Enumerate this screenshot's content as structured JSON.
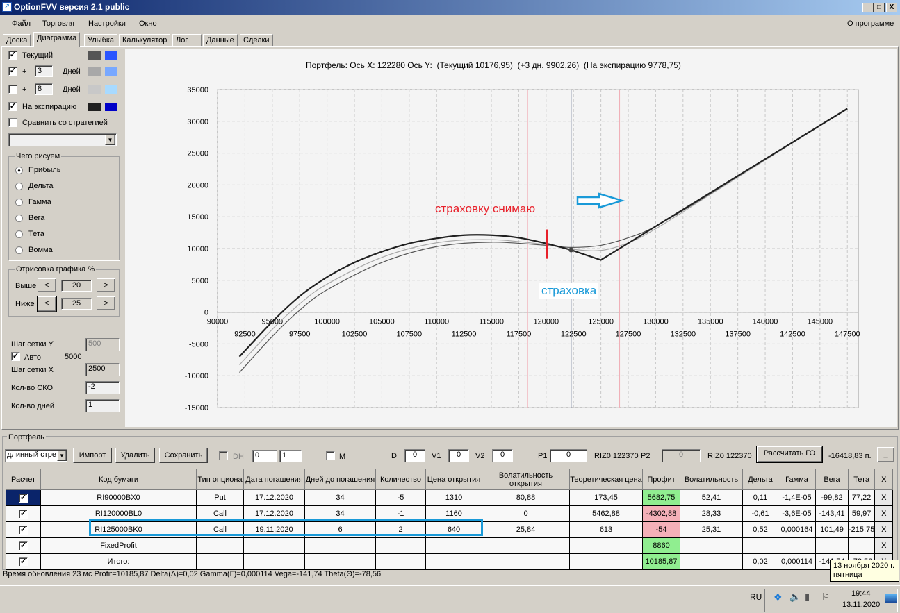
{
  "window": {
    "title": "OptionFVV версия 2.1 public",
    "minimize": "_",
    "maximize": "□",
    "close": "X"
  },
  "menu": {
    "items": [
      "Файл",
      "Торговля",
      "Настройки",
      "Окно"
    ],
    "about": "О программе"
  },
  "tabs": [
    "Доска",
    "Диаграмма",
    "Улыбка",
    "Калькулятор",
    "Лог",
    "Данные",
    "Сделки"
  ],
  "active_tab": "Диаграмма",
  "left_panel": {
    "current": {
      "label": "Текущий",
      "checked": true,
      "colors": [
        "#555555",
        "#2a55ff"
      ]
    },
    "plus1": {
      "plus": "+",
      "days": "3",
      "label": "Дней",
      "checked": true,
      "colors": [
        "#a8a8a8",
        "#78a8ff"
      ]
    },
    "plus2": {
      "plus": "+",
      "days": "8",
      "label": "Дней",
      "checked": false,
      "colors": [
        "#c8c8c8",
        "#a8daff"
      ]
    },
    "expiration": {
      "label": "На экспирацию",
      "checked": true,
      "colors": [
        "#202020",
        "#0000c8"
      ]
    },
    "compare": {
      "label": "Сравнить со стратегией",
      "checked": false
    },
    "what_title": "Чего рисуем",
    "what_options": [
      "Прибыль",
      "Дельта",
      "Гамма",
      "Вега",
      "Тета",
      "Вомма"
    ],
    "what_selected": "Прибыль",
    "draw_title": "Отрисовка графика %",
    "above_label": "Выше",
    "above_value": "20",
    "below_label": "Ниже",
    "below_value": "25",
    "prev": "<",
    "next": ">",
    "grid_y_label": "Шаг сетки Y",
    "grid_y_value": "500",
    "auto_label": "Авто",
    "auto_checked": true,
    "auto_value": "5000",
    "grid_x_label": "Шаг сетки X",
    "grid_x_value": "2500",
    "sko_label": "Кол-во СКО",
    "sko_value": "-2",
    "days_label": "Кол-во дней",
    "days_value": "1"
  },
  "chart_data": {
    "type": "line",
    "title": "Портфель: Ось X: 122280 Ось Y:  (Текущий 10176,95)  (+3 дн. 9902,26)  (На экспирацию 9778,75)",
    "xlim": [
      90000,
      148500
    ],
    "ylim": [
      -15000,
      35000
    ],
    "x_ticks_major": [
      90000,
      95000,
      100000,
      105000,
      110000,
      115000,
      120000,
      125000,
      130000,
      135000,
      140000,
      145000
    ],
    "x_ticks_minor": [
      92500,
      97500,
      102500,
      107500,
      112500,
      117500,
      122500,
      127500,
      132500,
      137500,
      142500,
      147500
    ],
    "y_ticks": [
      35000,
      30000,
      25000,
      20000,
      15000,
      10000,
      5000,
      0,
      -5000,
      -10000,
      -15000
    ],
    "grid": true,
    "series": [
      {
        "name": "Текущий",
        "color": "#555555",
        "points": [
          [
            92000,
            -9500
          ],
          [
            95000,
            -3800
          ],
          [
            97500,
            300
          ],
          [
            100000,
            3500
          ],
          [
            105000,
            7800
          ],
          [
            110000,
            10300
          ],
          [
            115000,
            11000
          ],
          [
            120000,
            10500
          ],
          [
            122280,
            10177
          ],
          [
            125000,
            10500
          ],
          [
            127500,
            11700
          ],
          [
            130000,
            13500
          ],
          [
            135000,
            18600
          ],
          [
            140000,
            24000
          ],
          [
            145000,
            29300
          ],
          [
            147500,
            31900
          ]
        ]
      },
      {
        "name": "+3 дн.",
        "color": "#a8a8a8",
        "points": [
          [
            92000,
            -8300
          ],
          [
            95000,
            -2700
          ],
          [
            97500,
            1300
          ],
          [
            100000,
            4400
          ],
          [
            105000,
            8600
          ],
          [
            110000,
            10900
          ],
          [
            115000,
            11400
          ],
          [
            120000,
            10600
          ],
          [
            122280,
            9902
          ],
          [
            125000,
            9700
          ],
          [
            127500,
            10900
          ],
          [
            130000,
            13100
          ],
          [
            135000,
            18500
          ],
          [
            140000,
            23900
          ],
          [
            145000,
            29300
          ],
          [
            147500,
            31900
          ]
        ]
      },
      {
        "name": "На экспирацию",
        "color": "#202020",
        "points": [
          [
            92000,
            -7000
          ],
          [
            95000,
            -1500
          ],
          [
            97500,
            2500
          ],
          [
            100000,
            5500
          ],
          [
            102500,
            7800
          ],
          [
            105000,
            9500
          ],
          [
            107500,
            10800
          ],
          [
            110000,
            11600
          ],
          [
            112500,
            12100
          ],
          [
            115000,
            12100
          ],
          [
            117500,
            11700
          ],
          [
            120000,
            10800
          ],
          [
            122280,
            9779
          ],
          [
            125000,
            8200
          ],
          [
            130000,
            13500
          ],
          [
            135000,
            18800
          ],
          [
            140000,
            24100
          ],
          [
            145000,
            29400
          ],
          [
            147500,
            32000
          ]
        ]
      }
    ],
    "vertical_lines": [
      {
        "x": 118300,
        "color": "#f0b0b8"
      },
      {
        "x": 122280,
        "color": "#8890a8"
      },
      {
        "x": 126700,
        "color": "#f0b0b8"
      }
    ],
    "current_point": [
      122280,
      9779
    ],
    "annotations": [
      {
        "text": "страховку снимаю",
        "color": "#e8202a"
      },
      {
        "text": "страховка",
        "color": "#1a9ad8"
      }
    ],
    "marker": {
      "x": 120100,
      "y_range": [
        8400,
        13000
      ],
      "color": "#e8202a"
    }
  },
  "portfolio": {
    "title": "Портфель",
    "strategy": "длинный стре",
    "import": "Импорт",
    "delete": "Удалить",
    "save": "Сохранить",
    "dh_label": "DH",
    "dh1": "0",
    "dh2": "1",
    "m_label": "M",
    "d_label": "D",
    "d_value": "0",
    "v1_label": "V1",
    "v1_value": "0",
    "v2_label": "V2",
    "v2_value": "0",
    "p1_label": "P1",
    "p1_value": "0",
    "p1_instr": "RIZ0 122370",
    "p2_label": "P2",
    "p2_value": "0",
    "p2_instr": "RIZ0 122370",
    "calc_go": "Рассчитать ГО",
    "go_value": "-16418,83 п.",
    "collapse": "_",
    "columns": [
      "Расчет",
      "Код бумаги",
      "Тип опциона",
      "Дата погашения",
      "Дней до погашения",
      "Количество",
      "Цена открытия",
      "Волатильность открытия",
      "Теоретическая цена",
      "Профит",
      "Волатильность",
      "Дельта",
      "Гамма",
      "Вега",
      "Тета",
      "X"
    ],
    "rows": [
      {
        "calc": true,
        "cells": [
          "RI90000BX0",
          "Put",
          "17.12.2020",
          "34",
          "-5",
          "1310",
          "80,88",
          "173,45",
          "5682,75",
          "52,41",
          "0,11",
          "-1,4E-05",
          "-99,82",
          "77,22",
          "X"
        ],
        "profit": "pos"
      },
      {
        "calc": true,
        "cells": [
          "RI120000BL0",
          "Call",
          "17.12.2020",
          "34",
          "-1",
          "1160",
          "0",
          "5462,88",
          "-4302,88",
          "28,33",
          "-0,61",
          "-3,6E-05",
          "-143,41",
          "59,97",
          "X"
        ],
        "profit": "neg"
      },
      {
        "calc": true,
        "cells": [
          "RI125000BK0",
          "Call",
          "19.11.2020",
          "6",
          "2",
          "640",
          "25,84",
          "613",
          "-54",
          "25,31",
          "0,52",
          "0,000164",
          "101,49",
          "-215,75",
          "X"
        ],
        "profit": "neg"
      },
      {
        "calc": true,
        "cells": [
          "FixedProfit",
          "",
          "",
          "",
          "",
          "",
          "",
          "",
          "8860",
          "",
          "",
          "",
          "",
          "",
          "X"
        ],
        "profit": "pos"
      },
      {
        "calc": true,
        "cells": [
          "Итого:",
          "",
          "",
          "",
          "",
          "",
          "",
          "",
          "10185,87",
          "",
          "0,02",
          "0,000114",
          "-141,74",
          "-78,56",
          "X"
        ],
        "profit": "pos"
      }
    ]
  },
  "status": "Время обновления 23 мс  Profit=10185,87 Delta(Δ)=0,02 Gamma(Γ)=0,000114 Vega=-141,74 Theta(Θ)=-78,56",
  "tooltip": {
    "line1": "13 ноября 2020 г.",
    "line2": "пятница"
  },
  "taskbar": {
    "lang": "RU",
    "time": "19:44",
    "date": "13.11.2020"
  }
}
